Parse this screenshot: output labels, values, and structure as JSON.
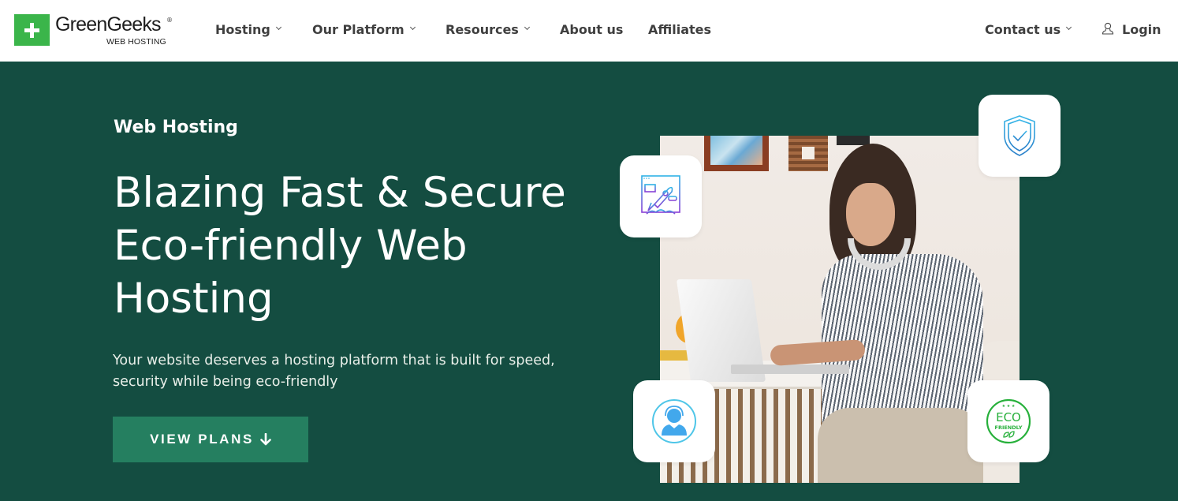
{
  "brand": {
    "name": "GreenGeeks",
    "registered_mark": "®",
    "tagline": "WEB HOSTING",
    "logo_icon": "plus-icon",
    "logo_color": "#3bb54a"
  },
  "nav": {
    "items": [
      {
        "label": "Hosting",
        "has_dropdown": true
      },
      {
        "label": "Our Platform",
        "has_dropdown": true
      },
      {
        "label": "Resources",
        "has_dropdown": true
      },
      {
        "label": "About us",
        "has_dropdown": false
      },
      {
        "label": "Affiliates",
        "has_dropdown": false
      }
    ],
    "contact": {
      "label": "Contact us",
      "has_dropdown": true
    },
    "login": {
      "label": "Login",
      "icon": "user-icon"
    }
  },
  "hero": {
    "eyebrow": "Web Hosting",
    "headline_lines": [
      "Blazing Fast & Secure",
      "Eco-friendly Web",
      "Hosting"
    ],
    "description_lines": [
      "Your website deserves a hosting platform that is built for speed,",
      "security while being eco-friendly"
    ],
    "cta": {
      "label": "VIEW PLANS",
      "icon": "arrow-down-icon",
      "arrow": "🡫"
    },
    "background_color": "#144d41",
    "cta_color": "#257f60"
  },
  "feature_badges": [
    {
      "name": "speed-rocket-icon",
      "description": "Rocket launching from browser window"
    },
    {
      "name": "security-shield-icon",
      "description": "Shield with checkmark"
    },
    {
      "name": "support-agent-icon",
      "description": "Support agent with headset"
    },
    {
      "name": "eco-friendly-icon",
      "text_top": "ECO",
      "text_bottom": "FRIENDLY"
    }
  ],
  "hero_image": {
    "description": "Woman with headphones typing on laptop at desk"
  }
}
